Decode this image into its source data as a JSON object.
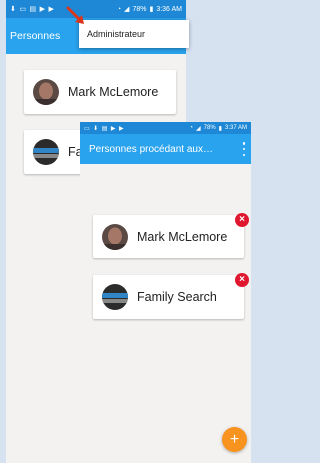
{
  "back_screen": {
    "status": {
      "time": "3:36 AM",
      "battery": "78%"
    },
    "title": "Personnes",
    "overflow_menu": {
      "items": [
        {
          "label": "Administrateur"
        }
      ]
    },
    "people": [
      {
        "name": "Mark McLemore"
      },
      {
        "name": "Fa"
      }
    ]
  },
  "front_screen": {
    "status": {
      "time": "3:37 AM",
      "battery": "78%"
    },
    "title": "Personnes procédant aux…",
    "people": [
      {
        "name": "Mark McLemore",
        "remove_icon": "remove-icon"
      },
      {
        "name": "Family Search",
        "remove_icon": "remove-icon"
      }
    ],
    "fab": {
      "icon": "plus-icon",
      "label": "+"
    }
  },
  "colors": {
    "status_bar": "#1e88d6",
    "app_bar": "#29a3ee",
    "remove": "#e0182f",
    "fab": "#f7931e",
    "arrow": "#d9361c"
  }
}
